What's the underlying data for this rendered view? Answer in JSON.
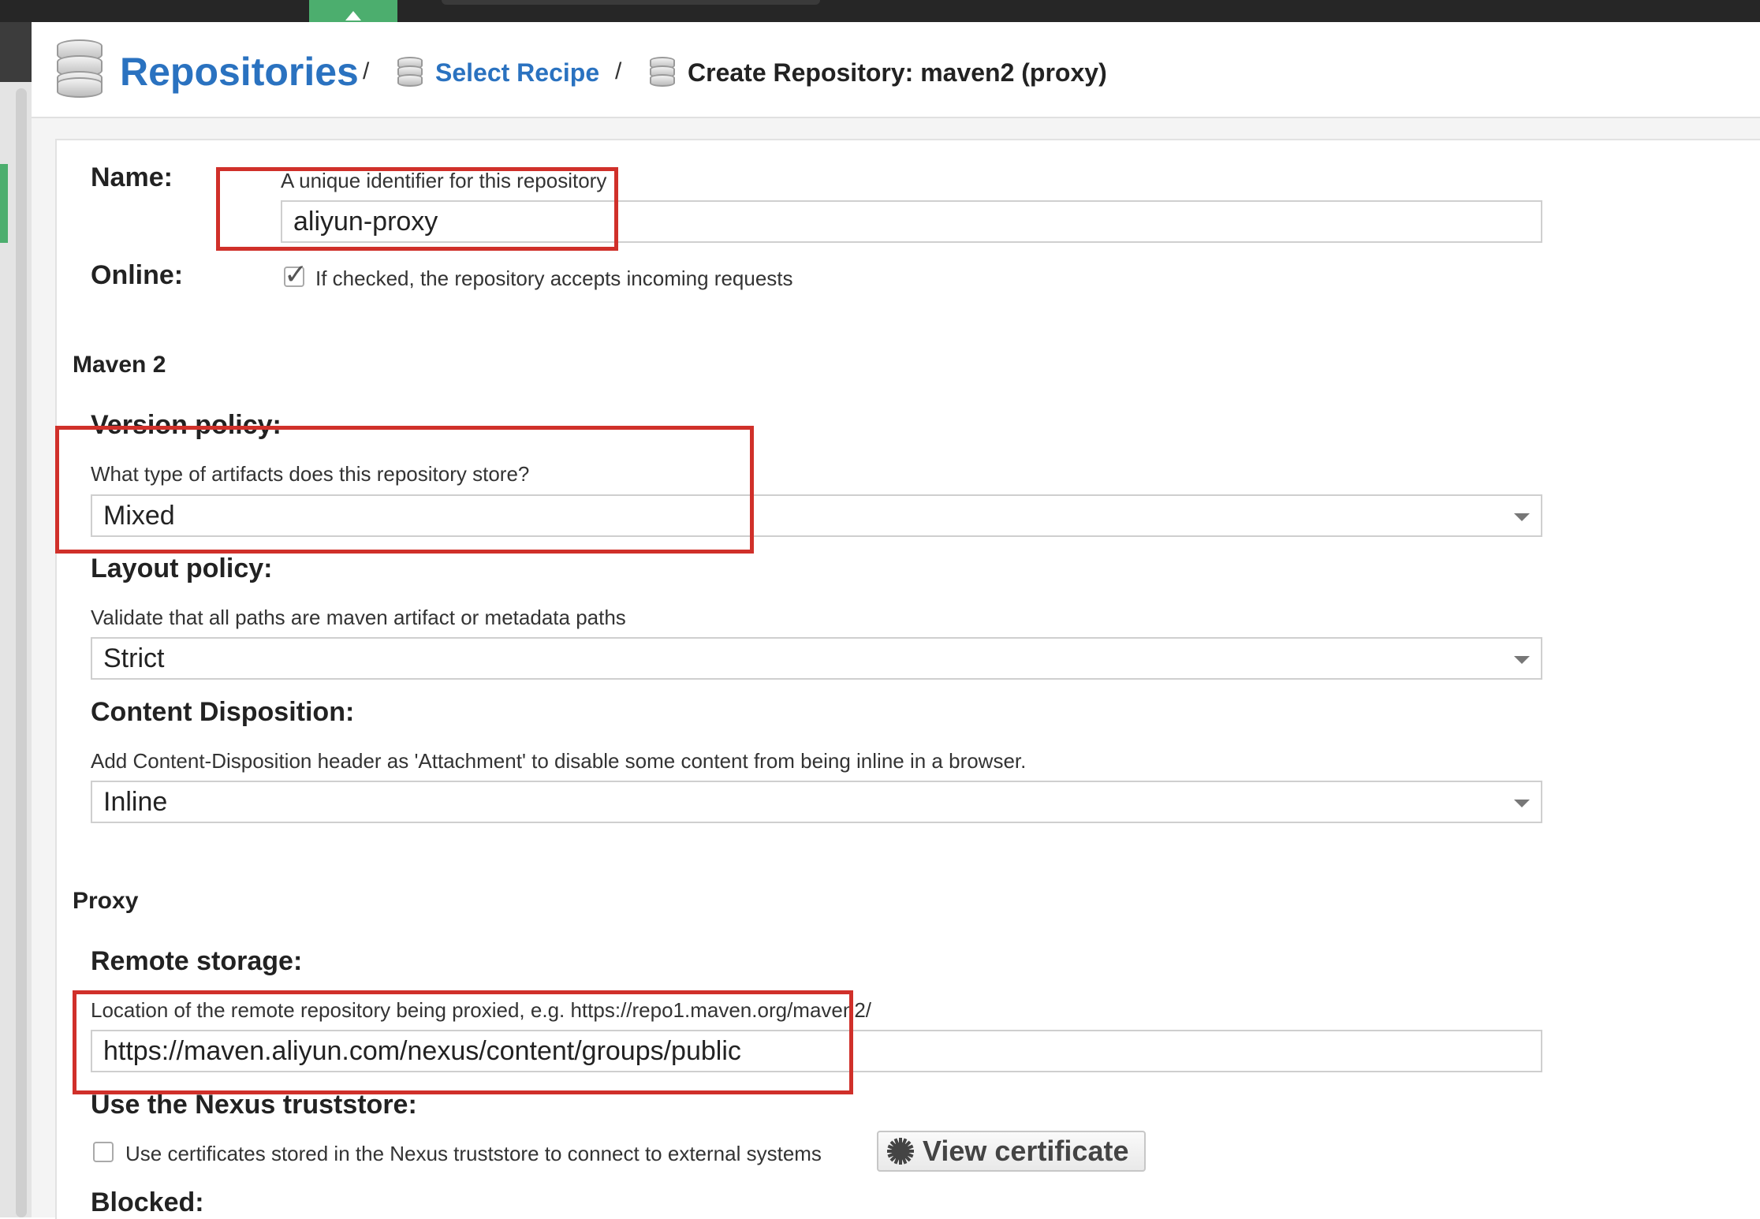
{
  "breadcrumb": {
    "root": "Repositories",
    "sep": "/",
    "step": "Select Recipe",
    "current": "Create Repository: maven2 (proxy)"
  },
  "form": {
    "name": {
      "label": "Name:",
      "help": "A unique identifier for this repository",
      "value": "aliyun-proxy"
    },
    "online": {
      "label": "Online:",
      "help": "If checked, the repository accepts incoming requests",
      "checked": true
    },
    "maven_section": "Maven 2",
    "version_policy": {
      "label": "Version policy:",
      "help": "What type of artifacts does this repository store?",
      "value": "Mixed"
    },
    "layout_policy": {
      "label": "Layout policy:",
      "help": "Validate that all paths are maven artifact or metadata paths",
      "value": "Strict"
    },
    "content_disposition": {
      "label": "Content Disposition:",
      "help": "Add Content-Disposition header as 'Attachment' to disable some content from being inline in a browser.",
      "value": "Inline"
    },
    "proxy_section": "Proxy",
    "remote_storage": {
      "label": "Remote storage:",
      "help": "Location of the remote repository being proxied, e.g. https://repo1.maven.org/maven2/",
      "value": "https://maven.aliyun.com/nexus/content/groups/public"
    },
    "truststore": {
      "label": "Use the Nexus truststore:",
      "help": "Use certificates stored in the Nexus truststore to connect to external systems",
      "checked": false,
      "button": "View certificate"
    },
    "blocked": {
      "label": "Blocked:"
    }
  },
  "colors": {
    "accent": "#2a72c0",
    "highlight": "#d0302a",
    "nav_green": "#4cae6e"
  }
}
